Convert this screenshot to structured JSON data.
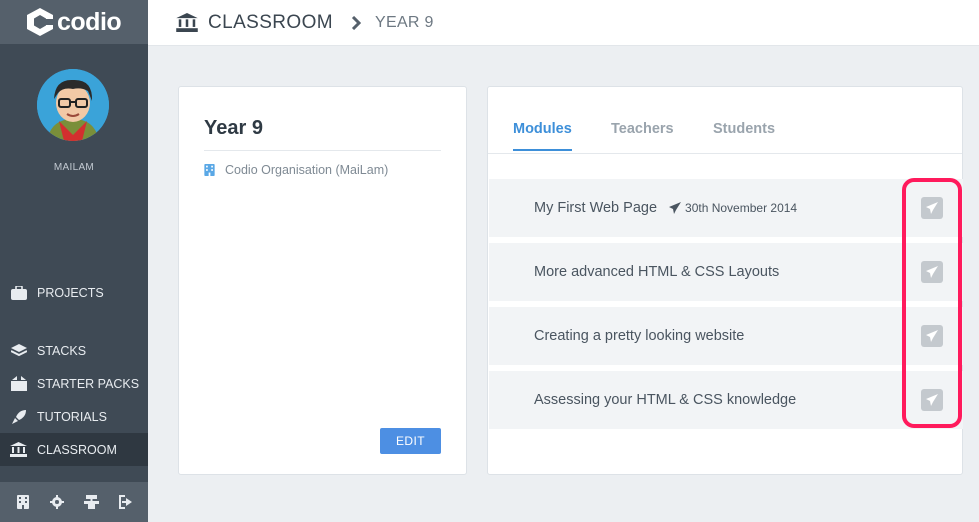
{
  "app": {
    "logo_text": "codio"
  },
  "sidebar": {
    "username": "MAILAM",
    "items": [
      {
        "label": "PROJECTS",
        "icon": "briefcase-icon"
      },
      {
        "label": "STACKS",
        "icon": "layers-icon"
      },
      {
        "label": "STARTER PACKS",
        "icon": "box-icon"
      },
      {
        "label": "TUTORIALS",
        "icon": "rocket-icon"
      },
      {
        "label": "CLASSROOM",
        "icon": "institution-icon",
        "active": true
      }
    ],
    "bottom_icons": [
      "building-icon",
      "gear-icon",
      "sitemap-icon",
      "sign-out-icon"
    ]
  },
  "header": {
    "section": "CLASSROOM",
    "subsection": "YEAR 9"
  },
  "class_card": {
    "title": "Year 9",
    "organisation": "Codio Organisation (MaiLam)",
    "edit_label": "EDIT"
  },
  "tabs": [
    {
      "label": "Modules",
      "active": true
    },
    {
      "label": "Teachers"
    },
    {
      "label": "Students"
    }
  ],
  "modules": [
    {
      "title": "My First Web Page",
      "date": "30th November 2014"
    },
    {
      "title": "More advanced HTML & CSS Layouts"
    },
    {
      "title": "Creating a pretty looking website"
    },
    {
      "title": "Assessing your HTML & CSS knowledge"
    }
  ],
  "colors": {
    "accent": "#3d8fd9",
    "highlight": "#ff1a5c",
    "edit_button": "#4d8fe3",
    "sidebar": "#3f4a55"
  }
}
